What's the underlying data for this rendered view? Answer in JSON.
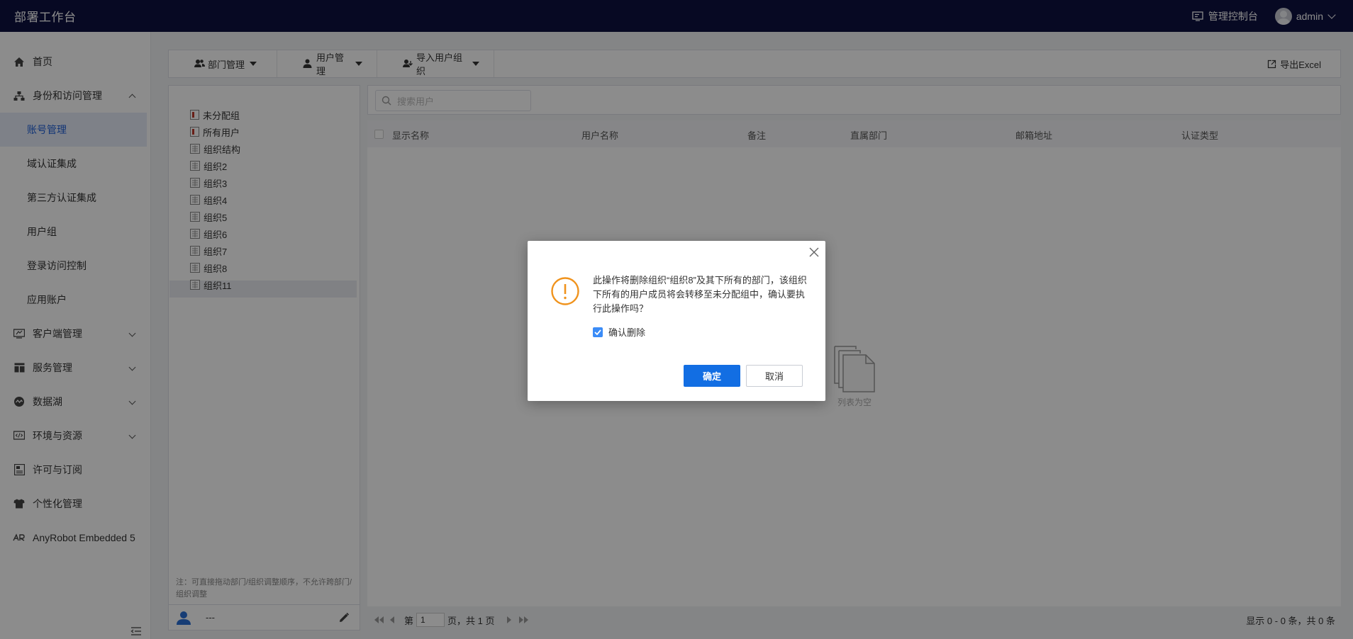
{
  "app": {
    "title": "部署工作台"
  },
  "topbar": {
    "console_label": "管理控制台",
    "user": "admin"
  },
  "sidebar": {
    "home": "首页",
    "iam": {
      "label": "身份和访问管理",
      "children": [
        "账号管理",
        "域认证集成",
        "第三方认证集成",
        "用户组",
        "登录访问控制",
        "应用账户"
      ],
      "active": "账号管理"
    },
    "client": "客户端管理",
    "service": "服务管理",
    "datalake": "数据湖",
    "env": "环境与资源",
    "license": "许可与订阅",
    "personal": "个性化管理",
    "anyrobot": "AnyRobot Embedded 5"
  },
  "toolbar": {
    "dept_mgmt": "部门管理",
    "user_mgmt": "用户管理",
    "import_org": "导入用户组织",
    "export": "导出Excel"
  },
  "tree": {
    "items": [
      "未分配组",
      "所有用户",
      "组织结构",
      "组织2",
      "组织3",
      "组织4",
      "组织5",
      "组织6",
      "组织7",
      "组织8",
      "组织11"
    ],
    "note": "注：可直接拖动部门/组织调整顺序，不允许跨部门/组织调整",
    "footer_text": "---"
  },
  "search": {
    "placeholder": "搜索用户"
  },
  "table": {
    "columns": [
      "显示名称",
      "用户名称",
      "备注",
      "直属部门",
      "邮箱地址",
      "认证类型"
    ],
    "empty_text": "列表为空"
  },
  "pager": {
    "prefix": "第",
    "page": "1",
    "suffix": "页，共 1 页",
    "summary": "显示 0 - 0 条，共 0 条"
  },
  "dialog": {
    "message": "此操作将删除组织“组织8”及其下所有的部门，该组织下所有的用户成员将会转移至未分配组中，确认要执行此操作吗？",
    "checkbox_label": "确认删除",
    "ok": "确定",
    "cancel": "取消"
  }
}
